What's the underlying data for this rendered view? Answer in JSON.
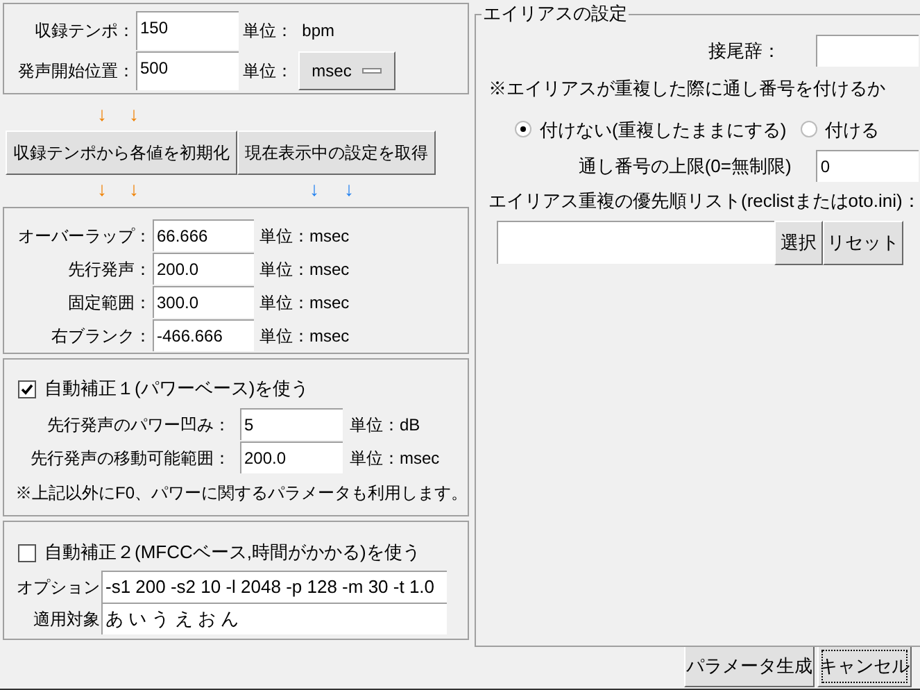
{
  "tempo_panel": {
    "rows": [
      {
        "kind": "unit_text",
        "label": "収録テンポ：",
        "value": "150",
        "unit": "単位：  bpm"
      },
      {
        "kind": "unit_dropdown",
        "label": "発声開始位置：",
        "value": "500",
        "unit": "単位：",
        "dropdown": "msec"
      }
    ]
  },
  "upper_arrows": [
    {
      "text": "↓",
      "color": "#f08000"
    },
    {
      "text": "↓",
      "color": "#f08000"
    }
  ],
  "action_buttons": [
    "収録テンポから各値を初期化",
    "現在表示中の設定を取得"
  ],
  "lower_arrows": [
    {
      "text": "↓",
      "color": "#f08000"
    },
    {
      "text": "↓",
      "color": "#f08000"
    },
    {
      "text": "↓",
      "color": "#2080f0"
    },
    {
      "text": "↓",
      "color": "#2080f0"
    }
  ],
  "params": [
    {
      "label": "オーバーラップ：",
      "value": "66.666",
      "unit": "単位：msec"
    },
    {
      "label": "先行発声：",
      "value": "200.0",
      "unit": "単位：msec"
    },
    {
      "label": "固定範囲：",
      "value": "300.0",
      "unit": "単位：msec"
    },
    {
      "label": "右ブランク：",
      "value": "-466.666",
      "unit": "単位：msec"
    }
  ],
  "auto_correction_1": {
    "label": "自動補正１(パワーベース)を使う",
    "checked": true,
    "rows": [
      {
        "label": "先行発声のパワー凹み：",
        "value": "5",
        "unit": "単位：dB"
      },
      {
        "label": "先行発声の移動可能範囲：",
        "value": "200.0",
        "unit": "単位：msec"
      }
    ],
    "note": "※上記以外にF0、パワーに関するパラメータも利用します。"
  },
  "auto_correction_2": {
    "label": "自動補正２(MFCCベース,時間がかかる)を使う",
    "checked": false,
    "rows": [
      {
        "label": "オプション",
        "value": "-s1 200 -s2 10 -l 2048 -p 128 -m 30 -t 1.0"
      },
      {
        "label": "適用対象",
        "value": "あ い う え お ん"
      }
    ]
  },
  "alias": {
    "title": "エイリアスの設定",
    "suffix_label": "接尾辞：",
    "note": "※エイリアスが重複した際に通し番号を付けるか",
    "radios": [
      {
        "label": "付けない(重複したままにする)",
        "selected": true
      },
      {
        "label": "付ける",
        "selected": false
      }
    ],
    "limit_label": "通し番号の上限(0=無制限)",
    "limit_value": "0",
    "list_label": "エイリアス重複の優先順リスト(reclistまたはoto.ini)：",
    "list_buttons": [
      "選択",
      "リセット"
    ]
  },
  "footer_buttons": [
    {
      "label": "パラメータ生成",
      "focused": false
    },
    {
      "label": "キャンセル",
      "focused": true
    }
  ]
}
